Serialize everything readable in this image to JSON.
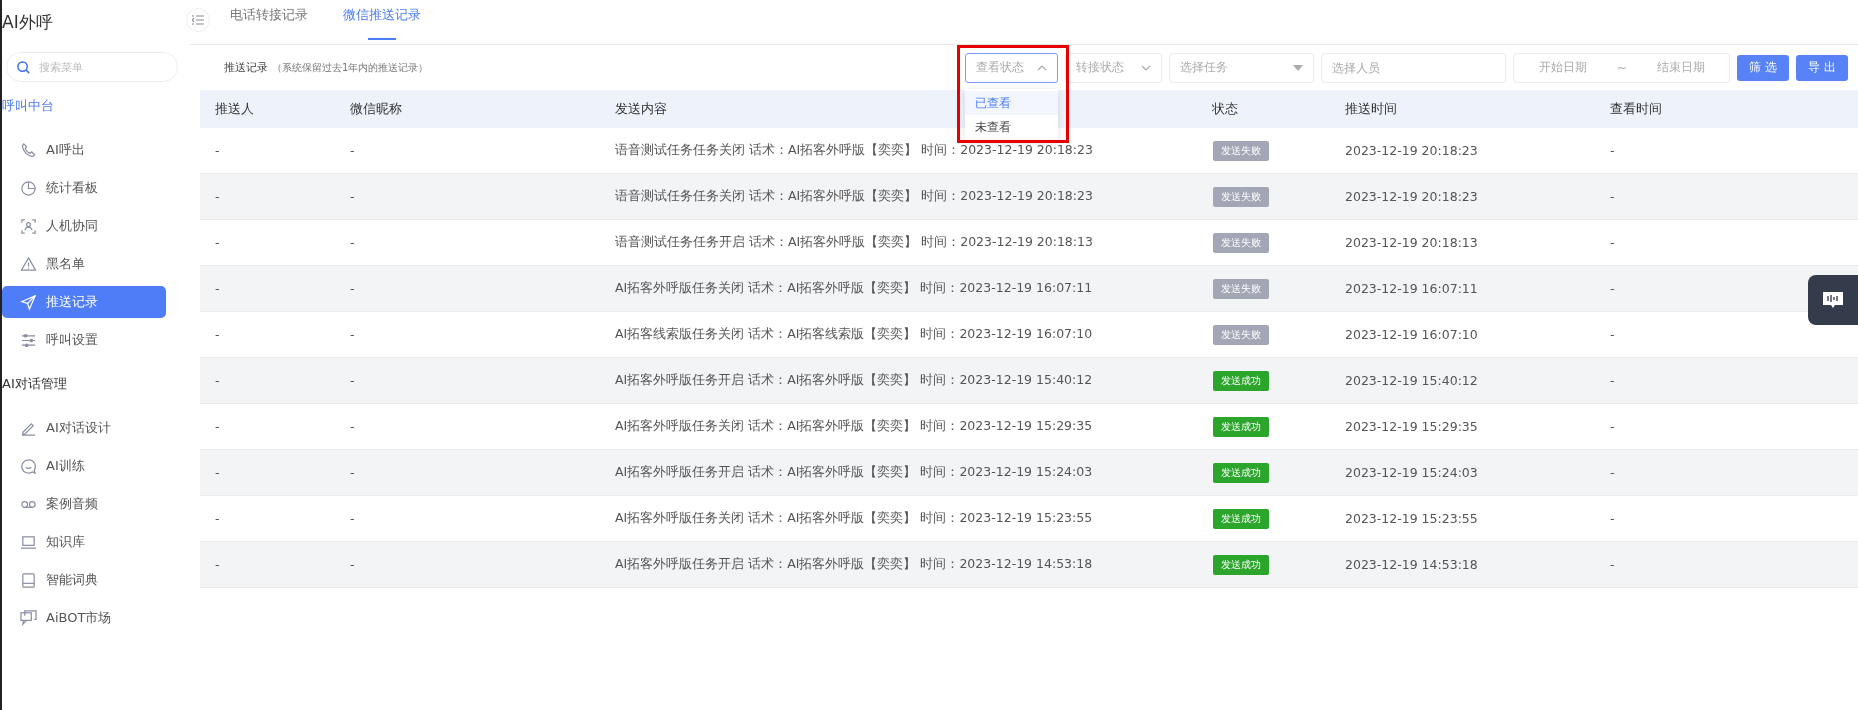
{
  "app": {
    "title": "AI外呼"
  },
  "sidebar": {
    "search": {
      "placeholder": "搜索菜单"
    },
    "groups": [
      {
        "label": "呼叫中台",
        "active": true,
        "items": [
          {
            "label": "AI呼出",
            "selected": false
          },
          {
            "label": "统计看板",
            "selected": false
          },
          {
            "label": "人机协同",
            "selected": false
          },
          {
            "label": "黑名单",
            "selected": false
          },
          {
            "label": "推送记录",
            "selected": true
          },
          {
            "label": "呼叫设置",
            "selected": false
          }
        ]
      },
      {
        "label": "AI对话管理",
        "active": false,
        "items": [
          {
            "label": "AI对话设计",
            "selected": false
          },
          {
            "label": "AI训练",
            "selected": false
          },
          {
            "label": "案例音频",
            "selected": false
          },
          {
            "label": "知识库",
            "selected": false
          },
          {
            "label": "智能词典",
            "selected": false
          },
          {
            "label": "AiBOT市场",
            "selected": false
          }
        ]
      }
    ]
  },
  "tabs": [
    {
      "label": "电话转接记录",
      "selected": false
    },
    {
      "label": "微信推送记录",
      "selected": true
    }
  ],
  "toolbar": {
    "title": "推送记录",
    "note": "（系统保留过去1年内的推送记录）",
    "view_status": {
      "placeholder": "查看状态",
      "expanded": true,
      "options": [
        {
          "label": "已查看",
          "selected": true
        },
        {
          "label": "未查看",
          "selected": false
        }
      ]
    },
    "transfer_status": {
      "placeholder": "转接状态",
      "expanded": false
    },
    "task": {
      "placeholder": "选择任务"
    },
    "person": {
      "placeholder": "选择人员"
    },
    "date_range": {
      "start_placeholder": "开始日期",
      "separator": "~",
      "end_placeholder": "结束日期"
    },
    "buttons": [
      "筛 选",
      "导 出"
    ]
  },
  "table": {
    "columns": [
      "推送人",
      "微信昵称",
      "发送内容",
      "状态",
      "推送时间",
      "查看时间"
    ],
    "rows": [
      {
        "pusher": "-",
        "nickname": "-",
        "content": "语音测试任务任务关闭 话术：AI拓客外呼版【奕奕】 时间：2023-12-19 20:18:23",
        "status": {
          "label": "发送失败",
          "kind": "failed"
        },
        "push_time": "2023-12-19 20:18:23",
        "view_time": "-"
      },
      {
        "pusher": "-",
        "nickname": "-",
        "content": "语音测试任务任务关闭 话术：AI拓客外呼版【奕奕】 时间：2023-12-19 20:18:23",
        "status": {
          "label": "发送失败",
          "kind": "failed"
        },
        "push_time": "2023-12-19 20:18:23",
        "view_time": "-"
      },
      {
        "pusher": "-",
        "nickname": "-",
        "content": "语音测试任务任务开启 话术：AI拓客外呼版【奕奕】 时间：2023-12-19 20:18:13",
        "status": {
          "label": "发送失败",
          "kind": "failed"
        },
        "push_time": "2023-12-19 20:18:13",
        "view_time": "-"
      },
      {
        "pusher": "-",
        "nickname": "-",
        "content": "AI拓客外呼版任务关闭 话术：AI拓客外呼版【奕奕】 时间：2023-12-19 16:07:11",
        "status": {
          "label": "发送失败",
          "kind": "failed"
        },
        "push_time": "2023-12-19 16:07:11",
        "view_time": "-"
      },
      {
        "pusher": "-",
        "nickname": "-",
        "content": "AI拓客线索版任务关闭 话术：AI拓客线索版【奕奕】 时间：2023-12-19 16:07:10",
        "status": {
          "label": "发送失败",
          "kind": "failed"
        },
        "push_time": "2023-12-19 16:07:10",
        "view_time": "-"
      },
      {
        "pusher": "-",
        "nickname": "-",
        "content": "AI拓客外呼版任务开启 话术：AI拓客外呼版【奕奕】 时间：2023-12-19 15:40:12",
        "status": {
          "label": "发送成功",
          "kind": "success"
        },
        "push_time": "2023-12-19 15:40:12",
        "view_time": "-"
      },
      {
        "pusher": "-",
        "nickname": "-",
        "content": "AI拓客外呼版任务关闭 话术：AI拓客外呼版【奕奕】 时间：2023-12-19 15:29:35",
        "status": {
          "label": "发送成功",
          "kind": "success"
        },
        "push_time": "2023-12-19 15:29:35",
        "view_time": "-"
      },
      {
        "pusher": "-",
        "nickname": "-",
        "content": "AI拓客外呼版任务开启 话术：AI拓客外呼版【奕奕】 时间：2023-12-19 15:24:03",
        "status": {
          "label": "发送成功",
          "kind": "success"
        },
        "push_time": "2023-12-19 15:24:03",
        "view_time": "-"
      },
      {
        "pusher": "-",
        "nickname": "-",
        "content": "AI拓客外呼版任务关闭 话术：AI拓客外呼版【奕奕】 时间：2023-12-19 15:23:55",
        "status": {
          "label": "发送成功",
          "kind": "success"
        },
        "push_time": "2023-12-19 15:23:55",
        "view_time": "-"
      },
      {
        "pusher": "-",
        "nickname": "-",
        "content": "AI拓客外呼版任务开启 话术：AI拓客外呼版【奕奕】 时间：2023-12-19 14:53:18",
        "status": {
          "label": "发送成功",
          "kind": "success"
        },
        "push_time": "2023-12-19 14:53:18",
        "view_time": "-"
      }
    ]
  }
}
